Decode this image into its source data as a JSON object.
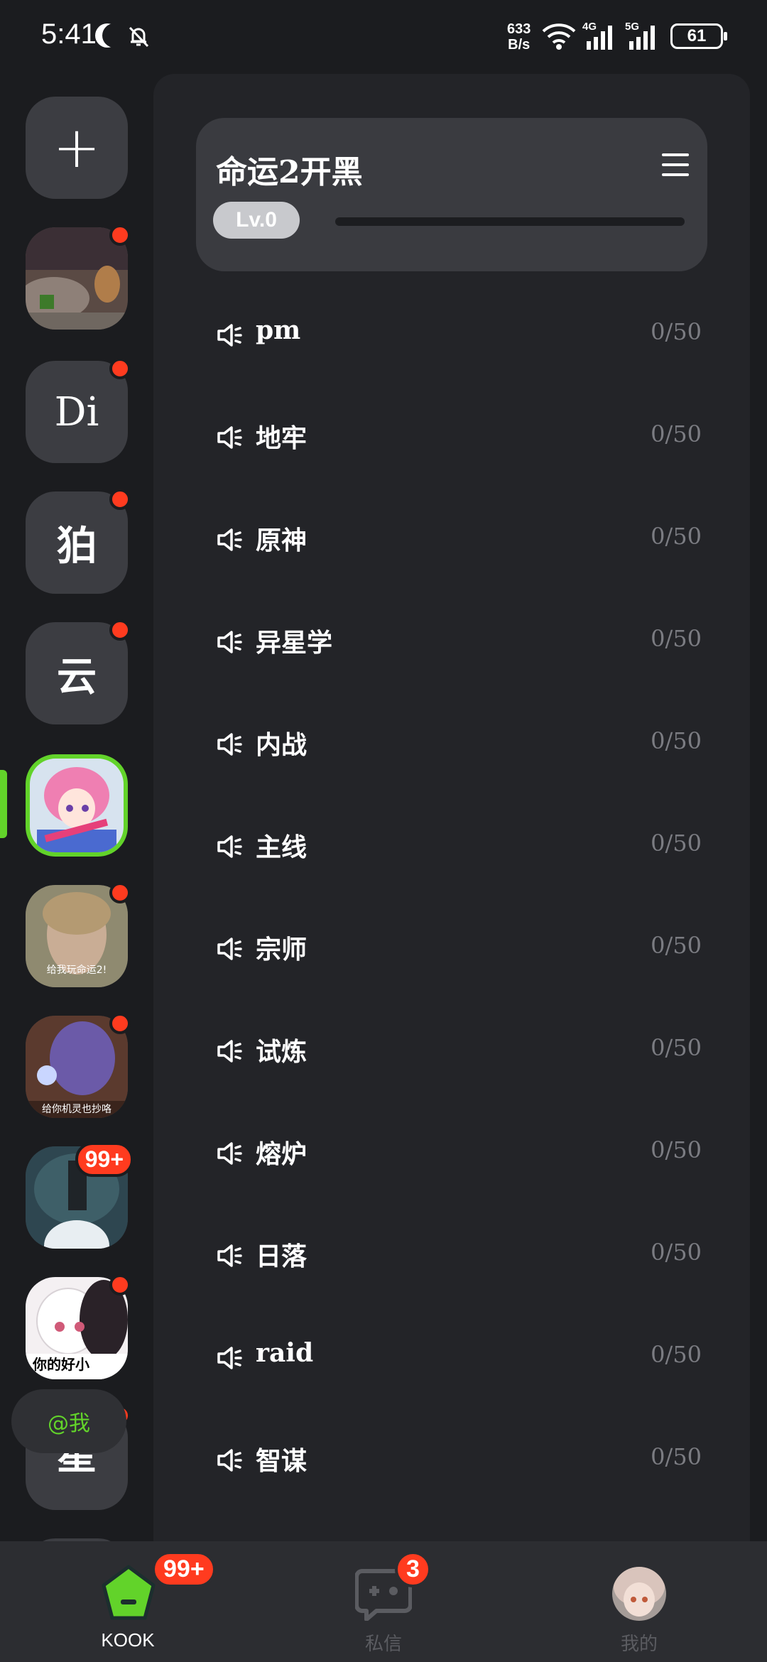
{
  "status_bar": {
    "time": "5:41",
    "net_speed_value": "633",
    "net_speed_unit": "B/s",
    "net_4g": "4G",
    "net_5g": "5G",
    "battery": "61"
  },
  "rail": {
    "add_label": "+",
    "servers": [
      {
        "type": "image",
        "icon": "wildlife-photo",
        "dot": true
      },
      {
        "type": "text",
        "label": "Di",
        "dot": true
      },
      {
        "type": "text",
        "label": "狛",
        "dot": true
      },
      {
        "type": "text",
        "label": "云",
        "dot": true
      },
      {
        "type": "image",
        "icon": "anime-girl-avatar",
        "active": true
      },
      {
        "type": "image",
        "icon": "meme-photo",
        "caption": "给我玩命运2!",
        "dot": true
      },
      {
        "type": "image",
        "icon": "game-character",
        "caption": "给你机灵也抄咯",
        "dot": true
      },
      {
        "type": "image",
        "icon": "dark-scene",
        "badge": "99+"
      },
      {
        "type": "image",
        "icon": "anime-meme",
        "caption": "你的好小",
        "dot": true
      },
      {
        "type": "text",
        "label": "星",
        "dot": true
      }
    ],
    "mention_label": "@我"
  },
  "guild": {
    "name": "命运2开黑",
    "level": "Lv.0",
    "level_progress": 0
  },
  "channels": [
    {
      "name": "pm",
      "count": "0/50"
    },
    {
      "name": "地牢",
      "count": "0/50"
    },
    {
      "name": "原神",
      "count": "0/50"
    },
    {
      "name": "异星学",
      "count": "0/50"
    },
    {
      "name": "内战",
      "count": "0/50"
    },
    {
      "name": "主线",
      "count": "0/50"
    },
    {
      "name": "宗师",
      "count": "0/50"
    },
    {
      "name": "试炼",
      "count": "0/50"
    },
    {
      "name": "熔炉",
      "count": "0/50"
    },
    {
      "name": "日落",
      "count": "0/50"
    },
    {
      "name": "raid",
      "count": "0/50"
    },
    {
      "name": "智谋",
      "count": "0/50"
    }
  ],
  "bottom_nav": {
    "kook_label": "KOOK",
    "kook_badge": "99+",
    "dm_label": "私信",
    "dm_badge": "3",
    "me_label": "我的"
  },
  "colors": {
    "accent": "#62d32a",
    "badge": "#ff3b1f",
    "panel": "#232428",
    "rail_bg": "#1b1c1f"
  }
}
